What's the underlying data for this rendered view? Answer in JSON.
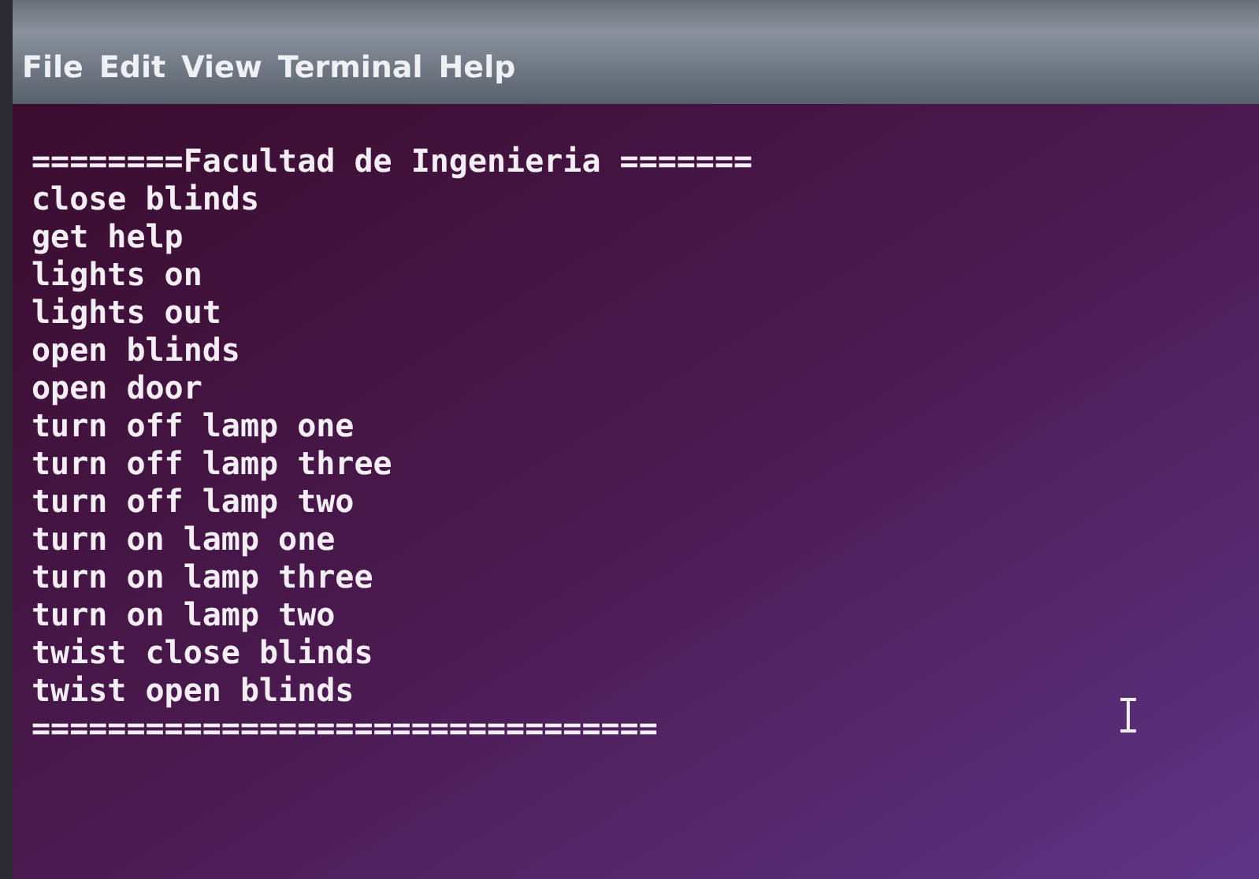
{
  "menu_bar": [
    "File",
    "Edit",
    "View",
    "Terminal",
    "Help"
  ],
  "terminal": {
    "lines": [
      "========Facultad de Ingenieria =======",
      "close blinds",
      "get help",
      "lights on",
      "lights out",
      "open blinds",
      "open door",
      "turn off lamp one",
      "turn off lamp three",
      "turn off lamp two",
      "turn on lamp one",
      "turn on lamp three",
      "turn on lamp two",
      "twist close blinds",
      "twist open blinds",
      "================================="
    ]
  }
}
